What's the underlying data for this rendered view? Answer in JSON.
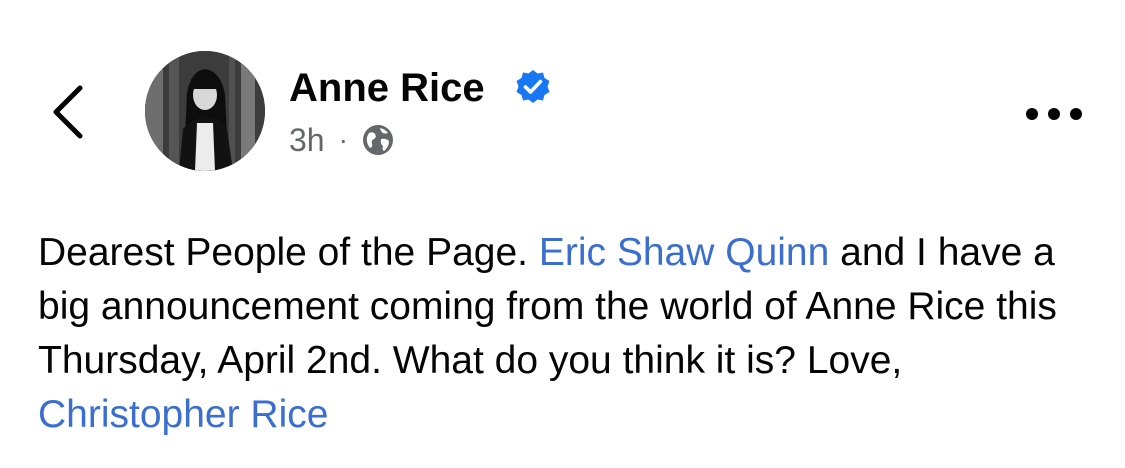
{
  "header": {
    "author_name": "Anne Rice",
    "timestamp": "3h",
    "separator": "·",
    "verified": true,
    "privacy_icon": "globe-icon",
    "back_icon": "chevron-left-icon",
    "more_icon": "more-horizontal-icon"
  },
  "post": {
    "segments": [
      {
        "type": "text",
        "text": "Dearest People of the Page. "
      },
      {
        "type": "mention",
        "text": "Eric Shaw Quinn"
      },
      {
        "type": "text",
        "text": " and I have a big announcement coming from the world of Anne Rice this Thursday, April 2nd. What do you think it is? Love, "
      },
      {
        "type": "mention",
        "text": "Christopher Rice"
      }
    ]
  },
  "colors": {
    "mention": "#3a6ecf",
    "verified_badge": "#1877f2",
    "meta_text": "#65676b",
    "body_text": "#050505"
  }
}
